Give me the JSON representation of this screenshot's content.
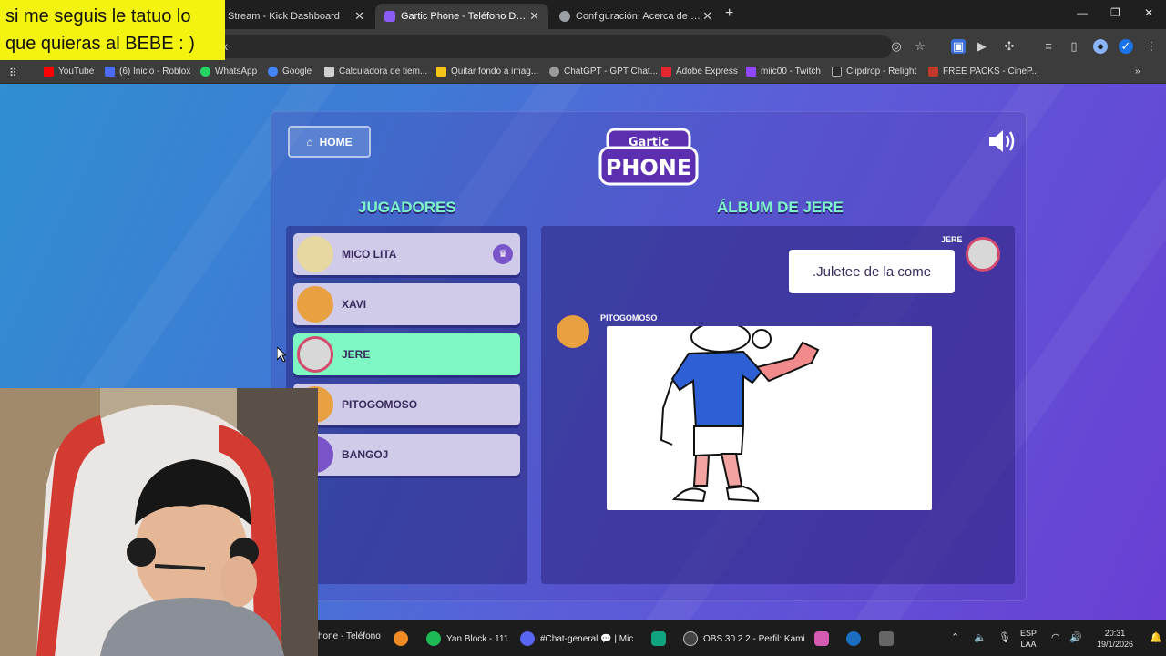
{
  "overlay": {
    "line1": "si me seguis le tatuo lo",
    "line2": "que quieras al BEBE : )"
  },
  "tabs": [
    {
      "title": "Stream - Kick Dashboard",
      "close": "✕"
    },
    {
      "title": "Gartic Phone - Teléfono Descon",
      "close": "✕",
      "active": true
    },
    {
      "title": "Configuración: Acerca de CClea",
      "close": "✕"
    }
  ],
  "newtab": "+",
  "address": {
    "partial": "k"
  },
  "bookmarks": [
    {
      "label": "YouTube",
      "color": "#ff0000"
    },
    {
      "label": "(6) Inicio - Roblox",
      "color": "#4a6cf7"
    },
    {
      "label": "WhatsApp",
      "color": "#25d366"
    },
    {
      "label": "Google",
      "color": "#4285f4"
    },
    {
      "label": "Calculadora de tiem...",
      "color": "#cfcfcf"
    },
    {
      "label": "Quitar fondo a imag...",
      "color": "#f5c518"
    },
    {
      "label": "ChatGPT - GPT Chat...",
      "color": "#9a9a9a"
    },
    {
      "label": "Adobe Express",
      "color": "#e3262f"
    },
    {
      "label": "miic00 - Twitch",
      "color": "#9146ff"
    },
    {
      "label": "Clipdrop - Relight",
      "color": "#2b2b2b"
    },
    {
      "label": "FREE PACKS - CineP...",
      "color": "#c0392b"
    }
  ],
  "game": {
    "home_label": "HOME",
    "logo_top": "Gartic",
    "logo_bottom": "PHONE",
    "players_title": "JUGADORES",
    "album_title": "ÁLBUM DE JERE",
    "players": [
      {
        "name": "MICO LITA",
        "host": true,
        "color": "#e7d7a0"
      },
      {
        "name": "XAVI",
        "color": "#e8a040"
      },
      {
        "name": "JERE",
        "selected": true,
        "color": "#d8d8d8"
      },
      {
        "name": "PITOGOMOSO",
        "color": "#e8a040"
      },
      {
        "name": "BANGOJ",
        "color": "#7a55c9"
      }
    ],
    "album": {
      "author": "JERE",
      "phrase": ".Juletee de la come",
      "drawer": "PITOGOMOSO"
    }
  },
  "taskbar": {
    "items": [
      {
        "label": "hone - Teléfono",
        "color": "#3b82f6"
      },
      {
        "label": "",
        "color": "#f08a24"
      },
      {
        "label": "Yan Block - 111",
        "color": "#1db954"
      },
      {
        "label": "#Chat-general 💬 | Mic",
        "color": "#5865f2"
      },
      {
        "label": "",
        "color": "#10a37f"
      },
      {
        "label": "OBS 30.2.2 - Perfil: Kami",
        "color": "#444"
      },
      {
        "label": "",
        "color": "#d45bb1"
      },
      {
        "label": "",
        "color": "#1b6ec2"
      },
      {
        "label": "",
        "color": "#666"
      }
    ],
    "lang1": "ESP",
    "lang2": "LAA",
    "time": "20:31",
    "date": "19/1/2026"
  }
}
